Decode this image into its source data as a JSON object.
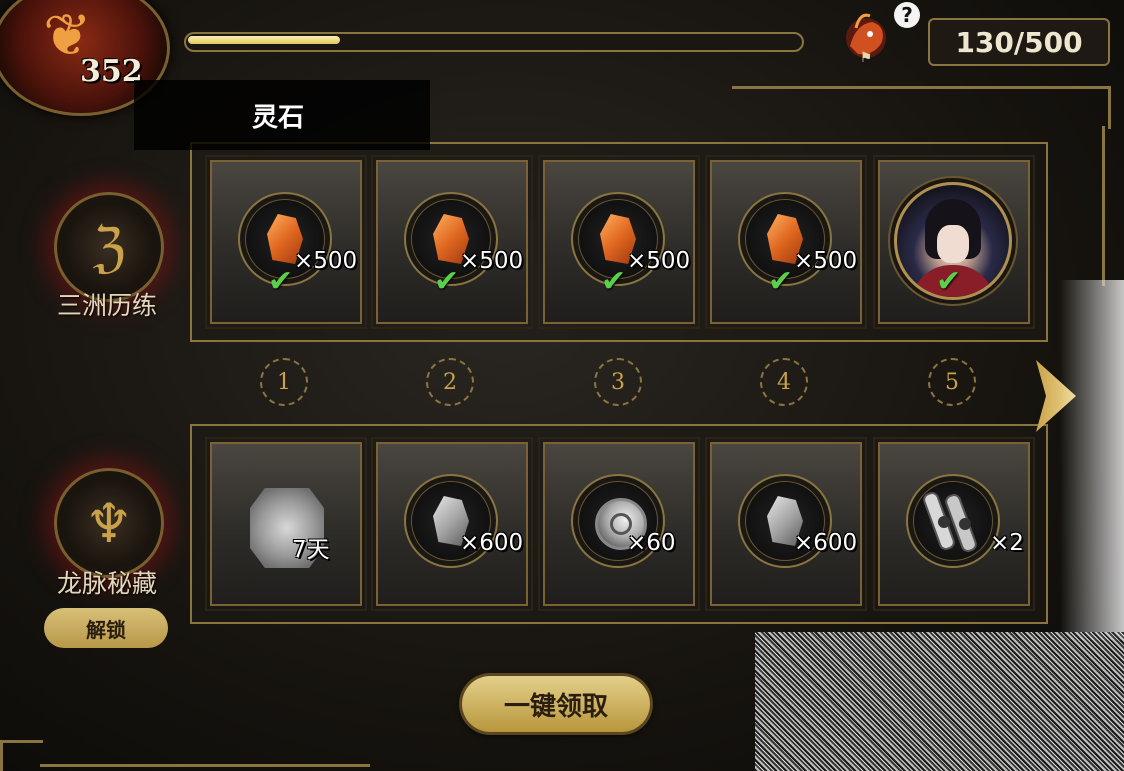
{
  "header": {
    "level": "352",
    "progress_fraction": 0.25,
    "counter": "130/500"
  },
  "tooltip": {
    "text": "灵石"
  },
  "tracks": [
    {
      "label": "三洲历练",
      "icon": "dragon-swirl-icon"
    },
    {
      "label": "龙脉秘藏",
      "icon": "demon-mask-icon",
      "unlock_label": "解锁"
    }
  ],
  "steps": [
    "1",
    "2",
    "3",
    "4",
    "5"
  ],
  "row1": [
    {
      "icon": "spirit-stone-icon",
      "qty": "×500",
      "claimed": true
    },
    {
      "icon": "spirit-stone-icon",
      "qty": "×500",
      "claimed": true
    },
    {
      "icon": "spirit-stone-icon",
      "qty": "×500",
      "claimed": true
    },
    {
      "icon": "spirit-stone-icon",
      "qty": "×500",
      "claimed": true
    },
    {
      "icon": "character-portrait-icon",
      "qty": "",
      "claimed": true
    }
  ],
  "row2": [
    {
      "icon": "amulet-icon",
      "qty": "7天"
    },
    {
      "icon": "grey-stone-icon",
      "qty": "×600"
    },
    {
      "icon": "shell-icon",
      "qty": "×60"
    },
    {
      "icon": "grey-stone-icon",
      "qty": "×600"
    },
    {
      "icon": "scroll-icon",
      "qty": "×2"
    }
  ],
  "claim_all_label": "一键领取",
  "check_glyph": "✔",
  "colors": {
    "gold": "#8a7440",
    "accent_green": "#5ad04a",
    "ember": "#f0a040"
  }
}
